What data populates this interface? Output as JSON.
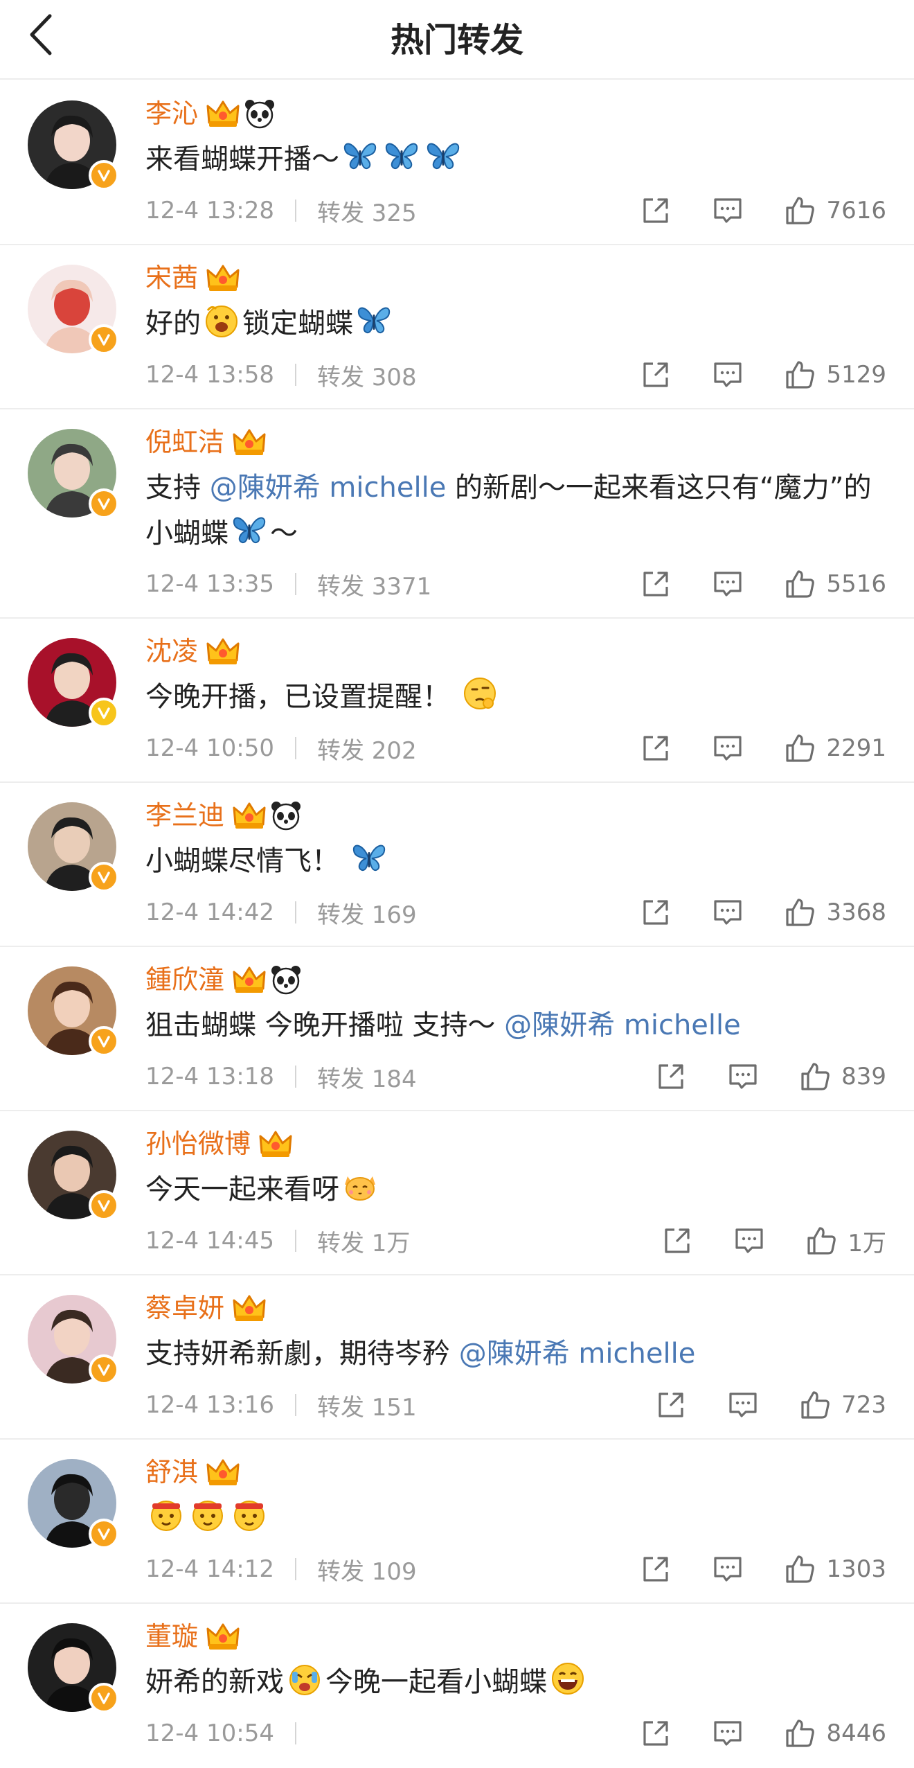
{
  "header": {
    "title": "热门转发",
    "back_icon": "chevron-left-icon"
  },
  "colors": {
    "name": "#e8701a",
    "mention": "#4a78b4",
    "meta": "#9a9a9a",
    "badge": "#f7a21b"
  },
  "items": [
    {
      "name": "李沁",
      "badges": [
        "crown-icon",
        "panda-icon"
      ],
      "text": [
        [
          "t",
          "来看蝴蝶开播～"
        ],
        [
          "e",
          "butterfly"
        ],
        [
          "e",
          "butterfly"
        ],
        [
          "e",
          "butterfly"
        ]
      ],
      "time": "12-4 13:28",
      "repost": "转发 325",
      "likes": "7616"
    },
    {
      "name": "宋茜",
      "badges": [
        "crown-icon"
      ],
      "text": [
        [
          "t",
          "好的"
        ],
        [
          "e",
          "grin"
        ],
        [
          "t",
          "锁定蝴蝶"
        ],
        [
          "e",
          "butterfly"
        ]
      ],
      "time": "12-4 13:58",
      "repost": "转发 308",
      "likes": "5129"
    },
    {
      "name": "倪虹洁",
      "badges": [
        "crown-icon"
      ],
      "text": [
        [
          "t",
          "支持 "
        ],
        [
          "m",
          "@陳妍希 michelle"
        ],
        [
          "t",
          " 的新剧～一起来看这只有“魔力”的小蝴蝶"
        ],
        [
          "e",
          "butterfly"
        ],
        [
          "t",
          "～"
        ]
      ],
      "time": "12-4 13:35",
      "repost": "转发 3371",
      "likes": "5516"
    },
    {
      "name": "沈凌",
      "badges": [
        "crown-icon"
      ],
      "text": [
        [
          "t",
          "今晚开播，已设置提醒！ "
        ],
        [
          "e",
          "think"
        ]
      ],
      "time": "12-4 10:50",
      "repost": "转发 202",
      "likes": "2291"
    },
    {
      "name": "李兰迪",
      "badges": [
        "crown-icon",
        "panda-icon"
      ],
      "text": [
        [
          "t",
          "小蝴蝶尽情飞！ "
        ],
        [
          "e",
          "butterfly"
        ]
      ],
      "time": "12-4 14:42",
      "repost": "转发 169",
      "likes": "3368"
    },
    {
      "name": "鍾欣潼",
      "badges": [
        "crown-icon",
        "panda-icon"
      ],
      "text": [
        [
          "t",
          "狙击蝴蝶 今晚开播啦 支持～ "
        ],
        [
          "m",
          "@陳妍希 michelle"
        ]
      ],
      "time": "12-4 13:18",
      "repost": "转发 184",
      "likes": "839"
    },
    {
      "name": "孙怡微博",
      "badges": [
        "crown-icon"
      ],
      "text": [
        [
          "t",
          "今天一起来看呀"
        ],
        [
          "e",
          "cat"
        ]
      ],
      "time": "12-4 14:45",
      "repost": "转发 1万",
      "likes": "1万"
    },
    {
      "name": "蔡卓妍",
      "badges": [
        "crown-icon"
      ],
      "text": [
        [
          "t",
          "支持妍希新劇，期待岑矜 "
        ],
        [
          "m",
          "@陳妍希 michelle"
        ]
      ],
      "time": "12-4 13:16",
      "repost": "转发 151",
      "likes": "723"
    },
    {
      "name": "舒淇",
      "badges": [
        "crown-icon"
      ],
      "text": [
        [
          "e",
          "fight"
        ],
        [
          "e",
          "fight"
        ],
        [
          "e",
          "fight"
        ]
      ],
      "time": "12-4 14:12",
      "repost": "转发 109",
      "likes": "1303"
    },
    {
      "name": "董璇",
      "badges": [
        "crown-icon"
      ],
      "text": [
        [
          "t",
          "妍希的新戏"
        ],
        [
          "e",
          "wow"
        ],
        [
          "t",
          "今晚一起看小蝴蝶"
        ],
        [
          "e",
          "laugh"
        ]
      ],
      "time": "12-4 10:54",
      "repost": "",
      "likes": "8446"
    }
  ]
}
